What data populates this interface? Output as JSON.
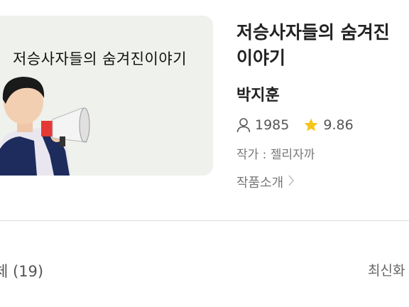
{
  "thumbnail": {
    "caption": "저승사자들의 숨겨진이야기"
  },
  "work": {
    "title": "저승사자들의 숨겨진 이야기",
    "name": "박지훈",
    "views": "1985",
    "rating": "9.86",
    "writer_label": "작가 : 젤리자까",
    "intro_label": "작품소개"
  },
  "episodes": {
    "count_label": "체 (19)",
    "sort_label": "최신화"
  },
  "icons": {
    "views": "person-icon",
    "rating": "star-icon",
    "intro": "chevron-right-icon"
  },
  "colors": {
    "star": "#f5c518"
  }
}
